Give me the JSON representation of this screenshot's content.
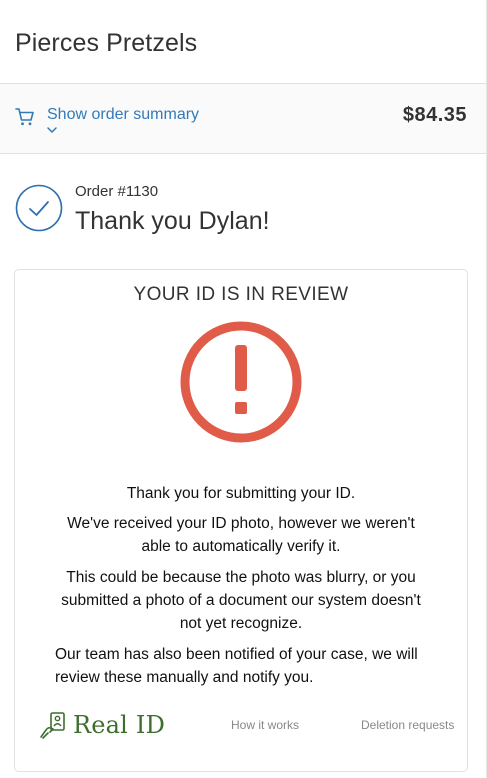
{
  "header": {
    "store_name": "Pierces Pretzels"
  },
  "summary": {
    "toggle_label": "Show order summary",
    "total": "$84.35"
  },
  "order": {
    "number": "Order #1130",
    "thank_you": "Thank you Dylan!"
  },
  "review": {
    "title": "YOUR ID IS IN REVIEW",
    "messages": [
      "Thank you for submitting your ID.",
      "We've received your ID photo, however we weren't able to automatically verify it.",
      "This could be because the photo was blurry, or you submitted a photo of a document our system doesn't not yet recognize.",
      "Our team has also been notified of your case, we will review these manually and notify you."
    ]
  },
  "footer": {
    "brand": "Real ID",
    "how_it_works": "How it works",
    "deletion_requests": "Deletion requests"
  },
  "colors": {
    "link_blue": "#337ab7",
    "alert_red": "#e05c49",
    "brand_green": "#3d6e2e",
    "check_blue": "#2f6fb0"
  },
  "icons": {
    "cart": "cart-icon",
    "chevron": "chevron-down-icon",
    "check": "check-circle-icon",
    "alert": "exclamation-circle-icon",
    "brand": "real-id-logo-icon"
  }
}
